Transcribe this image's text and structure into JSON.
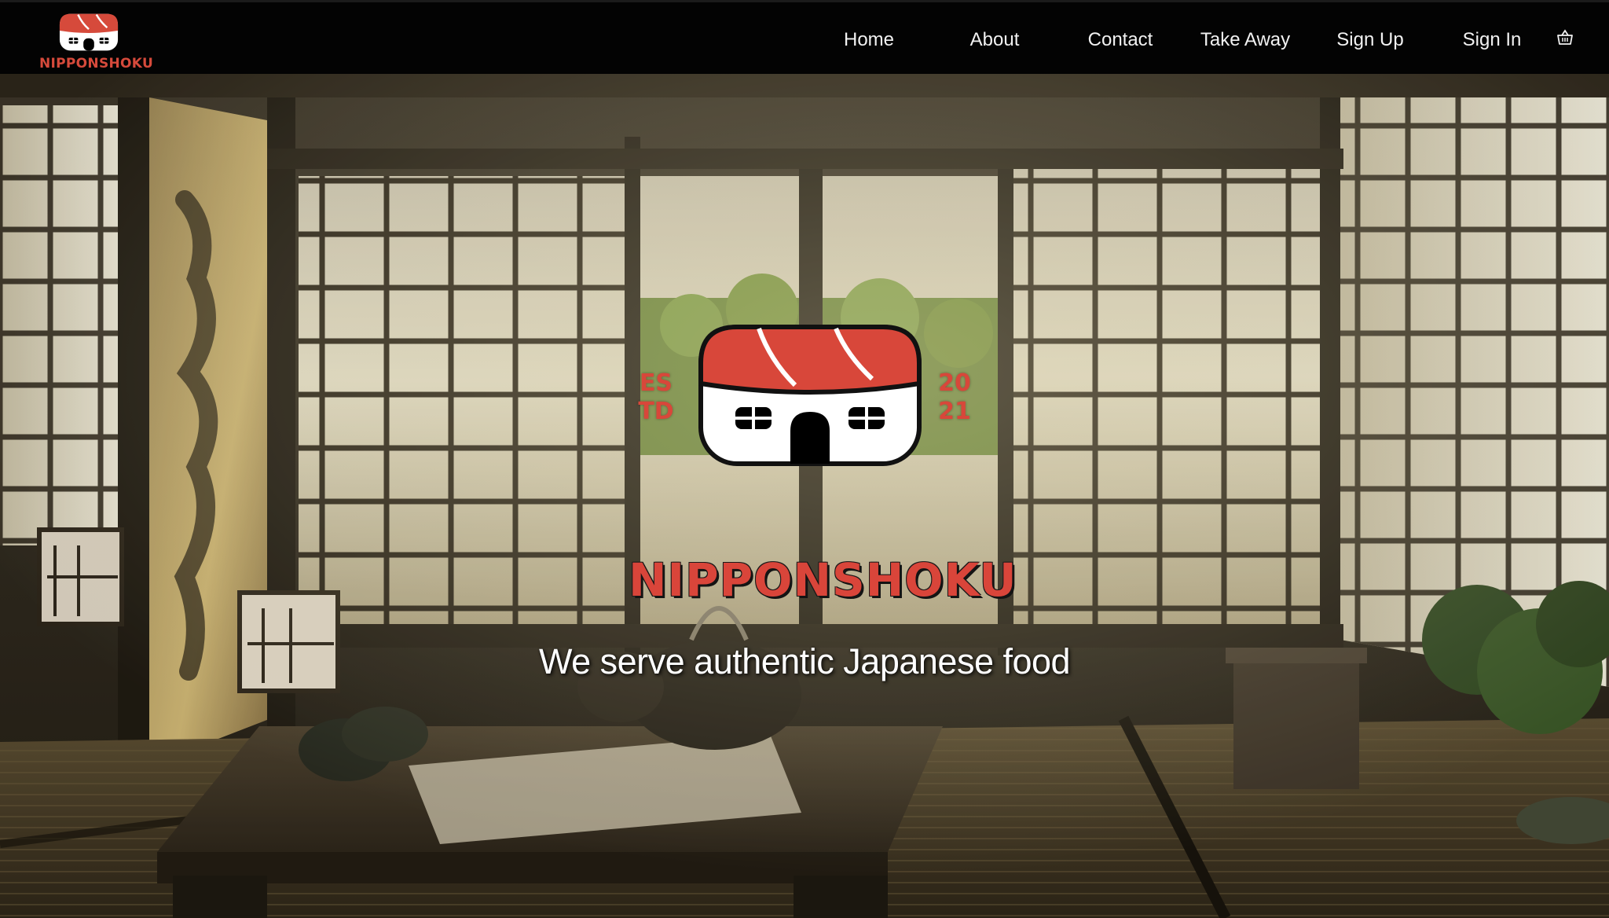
{
  "brand": {
    "name": "NIPPONSHOKU",
    "color": "#d64a3b"
  },
  "nav": {
    "items": [
      {
        "label": "Home"
      },
      {
        "label": "About"
      },
      {
        "label": "Contact"
      },
      {
        "label": "Take Away"
      },
      {
        "label": "Sign Up"
      },
      {
        "label": "Sign In"
      }
    ],
    "cart_icon": "basket-icon"
  },
  "hero": {
    "logo": {
      "est_line1": "ES",
      "est_line2": "TD",
      "year_line1": "20",
      "year_line2": "21",
      "name": "NIPPONSHOKU"
    },
    "tagline": "We serve authentic Japanese food",
    "background": "japanese-tea-room-image"
  },
  "colors": {
    "accent_red": "#d64a3b",
    "navbar_bg": "#030303"
  }
}
